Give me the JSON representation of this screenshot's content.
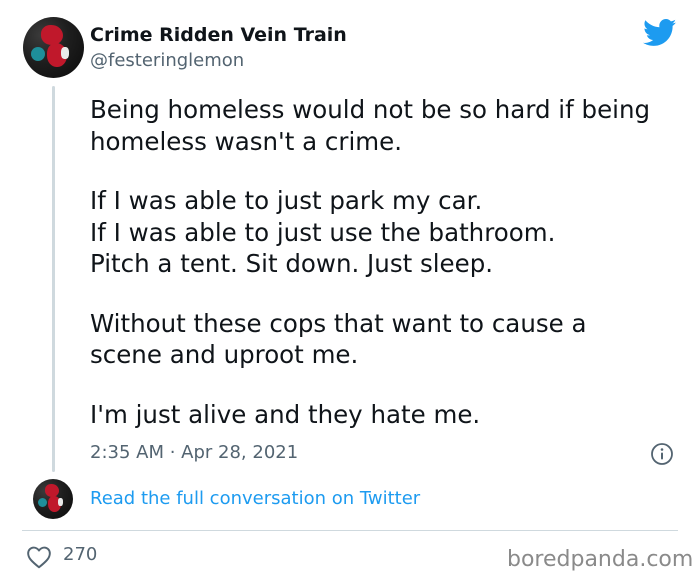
{
  "tweet": {
    "display_name": "Crime Ridden Vein Train",
    "handle": "@festeringlemon",
    "lines": [
      "Being homeless would not be so hard if being",
      "homeless wasn't a crime.",
      "",
      "If I was able to just park my car.",
      "If I was able to just use the bathroom.",
      "Pitch a tent. Sit down. Just sleep.",
      "",
      "Without these cops that want to cause a",
      "scene and uproot me.",
      "",
      "I'm just alive and they hate me."
    ],
    "timestamp": "2:35 AM · Apr 28, 2021",
    "conversation_link": "Read the full conversation on Twitter",
    "like_count": "270"
  },
  "icons": {
    "brand": "twitter-bird-icon",
    "info": "info-icon",
    "like": "heart-icon"
  },
  "watermark": "boredpanda.com",
  "colors": {
    "twitter_blue": "#1d9bf0",
    "text_primary": "#0f1419",
    "text_secondary": "#536471",
    "divider": "#cfd9de"
  }
}
